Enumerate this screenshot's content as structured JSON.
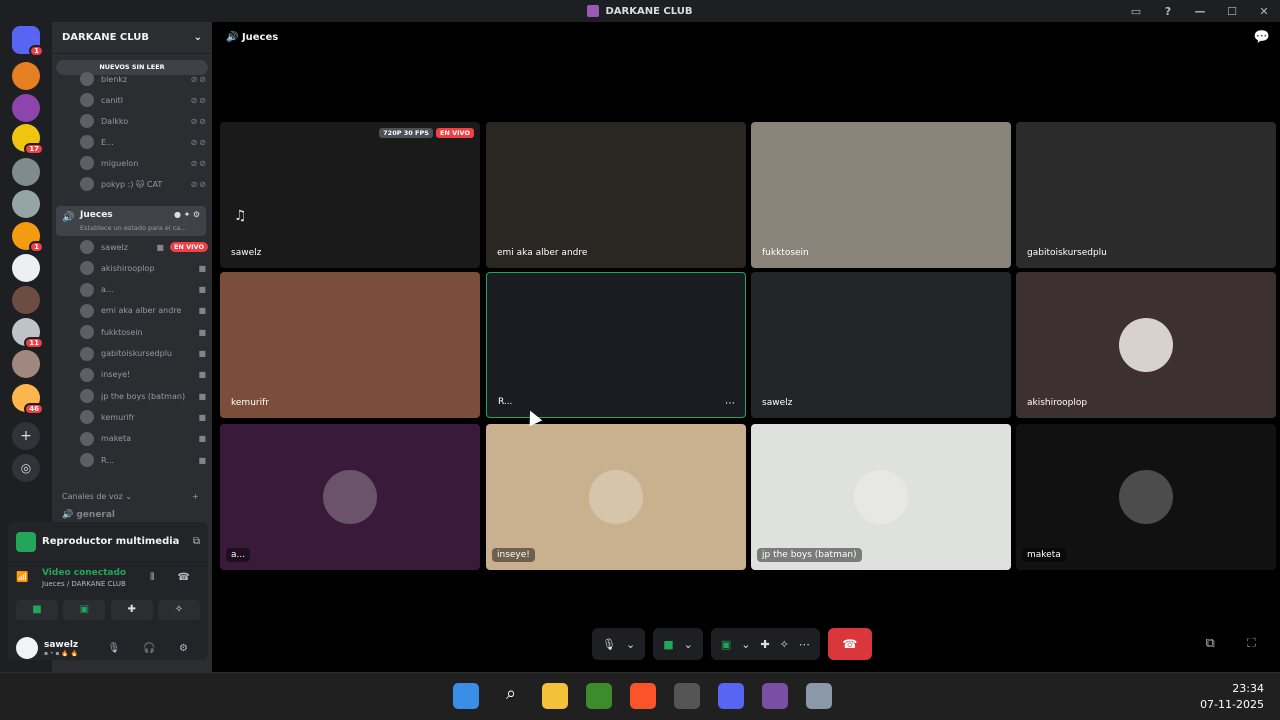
{
  "window": {
    "title": "DARKANE CLUB"
  },
  "server_rail": [
    {
      "name": "discord-home",
      "badge": "1",
      "color": "#5865f2"
    },
    {
      "name": "server-1",
      "badge": "",
      "color": "#e67e22"
    },
    {
      "name": "server-2",
      "badge": "",
      "color": "#8e44ad"
    },
    {
      "name": "server-3",
      "badge": "17",
      "color": "#f1c40f"
    },
    {
      "name": "server-4",
      "badge": "",
      "color": "#7f8c8d"
    },
    {
      "name": "server-5",
      "badge": "",
      "color": "#95a5a6"
    },
    {
      "name": "server-6",
      "badge": "1",
      "color": "#f39c12"
    },
    {
      "name": "server-7",
      "badge": "",
      "color": "#ecf0f1"
    },
    {
      "name": "server-8",
      "badge": "",
      "color": "#6d4c41"
    },
    {
      "name": "server-9",
      "badge": "11",
      "color": "#bdc3c7"
    },
    {
      "name": "server-10",
      "badge": "",
      "color": "#a1887f"
    },
    {
      "name": "server-11",
      "badge": "46",
      "color": "#ffb74d"
    }
  ],
  "sidebar": {
    "server_name": "DARKANE CLUB",
    "unread_pill": "NUEVOS SIN LEER",
    "members_top": [
      {
        "name": "blenkz"
      },
      {
        "name": "canitl"
      },
      {
        "name": "Dalkko"
      },
      {
        "name": "E..."
      },
      {
        "name": "miguelon"
      },
      {
        "name": "pokyp :) 🐱 CAT"
      }
    ],
    "voice_channel": {
      "name": "Jueces",
      "status": "Establece un estado para el ca..."
    },
    "voice_members": [
      {
        "name": "sawelz",
        "live": "EN VIVO"
      },
      {
        "name": "akishirooplop",
        "live": ""
      },
      {
        "name": "a...",
        "live": ""
      },
      {
        "name": "emi aka alber andre",
        "live": ""
      },
      {
        "name": "fukktosein",
        "live": ""
      },
      {
        "name": "gabitoiskursedplu",
        "live": ""
      },
      {
        "name": "inseye!",
        "live": ""
      },
      {
        "name": "jp the boys (batman)",
        "live": ""
      },
      {
        "name": "kemurifr",
        "live": ""
      },
      {
        "name": "maketa",
        "live": ""
      },
      {
        "name": "R...",
        "live": ""
      }
    ],
    "voice_category": "Canales de voz",
    "channel_general": "general"
  },
  "panel": {
    "media_title": "Reproductor multimedia",
    "voice_status": "Video conectado",
    "voice_location": "Jueces / DARKANE CLUB",
    "user_name": "sawelz",
    "user_tag": "▪ • ▪ 🔥 🔥"
  },
  "stage": {
    "channel_title": "Jueces",
    "tiles": [
      {
        "label": "sawelz",
        "bg": "#1a1a1a",
        "tag1": "720P 30 FPS",
        "tag2": "EN VIVO"
      },
      {
        "label": "emi aka alber andre",
        "bg": "#2a2622"
      },
      {
        "label": "fukktosein",
        "bg": "#8a837a"
      },
      {
        "label": "gabitoiskursedplu",
        "bg": "#2b2b2b"
      },
      {
        "label": "kemurifr",
        "bg": "#7a4e3a"
      },
      {
        "label": "R...",
        "bg": "#1b1b22"
      },
      {
        "label": "sawelz",
        "bg": "#232628"
      },
      {
        "label": "akishirooplop",
        "bg": "#3d3030"
      },
      {
        "label": "a...",
        "bg": "#3a1a3a"
      },
      {
        "label": "inseye!",
        "bg": "#c9b08f"
      },
      {
        "label": "jp the boys (batman)",
        "bg": "#dfe1de"
      },
      {
        "label": "maketa",
        "bg": "#111111"
      }
    ]
  },
  "taskbar": {
    "time": "23:34",
    "date": "07-11-2025"
  },
  "colors": {
    "live_red": "#f23f43",
    "green": "#23a55a",
    "accent": "#5865f2",
    "hang": "#da373c"
  }
}
